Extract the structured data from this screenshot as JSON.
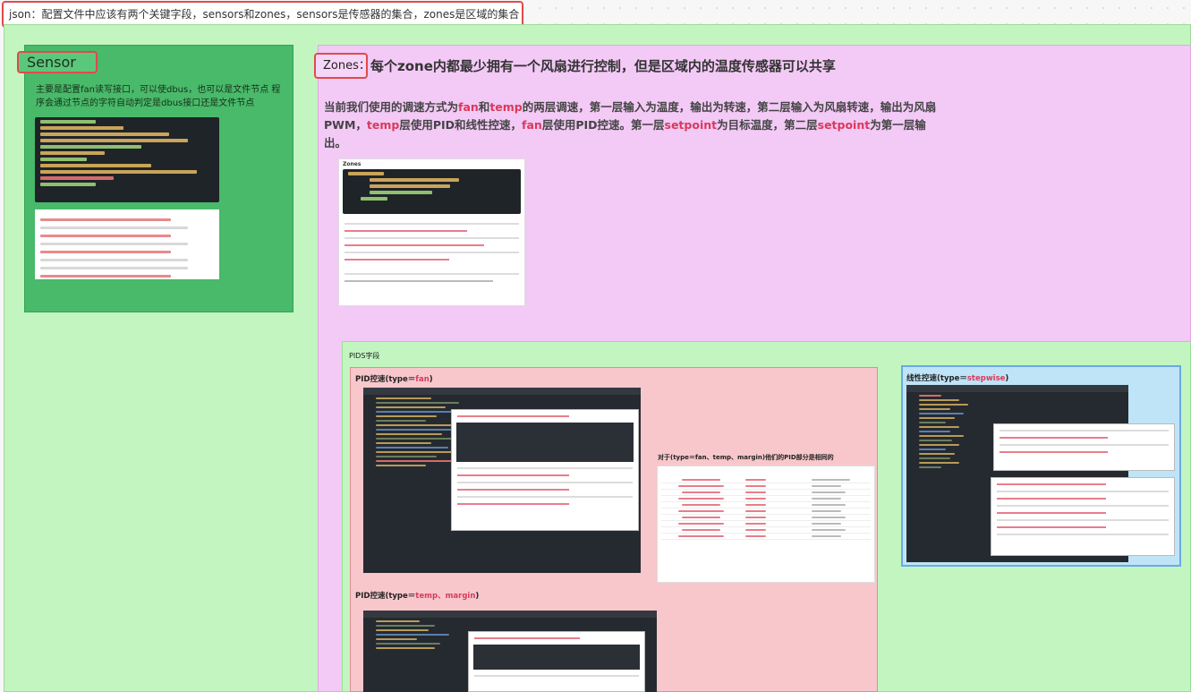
{
  "top_note": "json：配置文件中应该有两个关键字段，sensors和zones，sensors是传感器的集合，zones是区域的集合",
  "sensor": {
    "title": "Sensor",
    "description": "主要是配置fan读写接口，可以使dbus，也可以是文件节点 程序会通过节点的字符自动判定是dbus接口还是文件节点"
  },
  "zones": {
    "title": "Zones：",
    "heading": "每个zone内都最少拥有一个风扇进行控制，但是区域内的温度传感器可以共享",
    "desc_parts": {
      "p1": "当前我们使用的调速方式为",
      "fan1": "fan",
      "p2": "和",
      "temp1": "temp",
      "p3": "的两层调速，第一层输入为温度，输出为转速，第二层输入为风扇转速，输出为风扇PWM，",
      "temp2": "temp",
      "p4": "层使用PID和线性控速，",
      "fan2": "fan",
      "p5": "层使用PID控速。第一层",
      "sp1": "setpoint",
      "p6": "为目标温度，第二层",
      "sp2": "setpoint",
      "p7": "为第一层输出。"
    },
    "image_label": "Zones"
  },
  "pids": {
    "label": "PIDS字段",
    "fan_label": {
      "prefix": "PID控速(type＝",
      "type": "fan",
      "suffix": ")"
    },
    "temp_label": {
      "prefix": "PID控速(type＝",
      "type": "temp、margin",
      "suffix": ")"
    },
    "same_label": "对于(type＝fan、temp、margin)他们的PID部分是相同的",
    "stepwise_label": {
      "prefix": "线性控速(type＝",
      "type": "stepwise",
      "suffix": ")"
    }
  },
  "colors": {
    "highlight": "#d83a5a",
    "sensor_green": "#49b96a",
    "zones_pink": "#f3c9f6",
    "outer_green": "#c3f5c0",
    "fan_pink": "#f7c7cc",
    "stepwise_blue": "#bfe4f7",
    "annotation_red": "#e04a4a"
  }
}
